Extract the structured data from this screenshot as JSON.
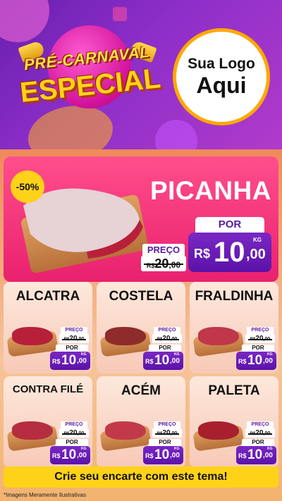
{
  "header": {
    "title_line1": "PRÉ-CARNAVAL",
    "title_line2": "ESPECIAL",
    "logo_line1": "Sua Logo",
    "logo_line2": "Aqui"
  },
  "hero": {
    "product": "PICANHA",
    "discount": "-50%",
    "preco_label": "PREÇO",
    "old_price_currency": "R$",
    "old_price_int": "20",
    "old_price_dec": ",00",
    "por_label": "POR",
    "currency": "R$",
    "price_int": "10",
    "price_dec": ",00",
    "price_unit": "KG"
  },
  "cards": [
    {
      "name": "ALCATRA",
      "preco_label": "PREÇO",
      "old_currency": "R$",
      "old_int": "20",
      "old_dec": ",00",
      "por_label": "POR",
      "currency": "R$",
      "price_int": "10",
      "price_dec": ",00",
      "unit": "KG"
    },
    {
      "name": "COSTELA",
      "preco_label": "PREÇO",
      "old_currency": "R$",
      "old_int": "20",
      "old_dec": ",00",
      "por_label": "POR",
      "currency": "R$",
      "price_int": "10",
      "price_dec": ",00",
      "unit": "KG"
    },
    {
      "name": "FRALDINHA",
      "preco_label": "PREÇO",
      "old_currency": "R$",
      "old_int": "20",
      "old_dec": ",00",
      "por_label": "POR",
      "currency": "R$",
      "price_int": "10",
      "price_dec": ",00",
      "unit": "KG"
    },
    {
      "name": "CONTRA FILÉ",
      "preco_label": "PREÇO",
      "old_currency": "R$",
      "old_int": "20",
      "old_dec": ",00",
      "por_label": "POR",
      "currency": "R$",
      "price_int": "10",
      "price_dec": ",00",
      "unit": "KG"
    },
    {
      "name": "ACÉM",
      "preco_label": "PREÇO",
      "old_currency": "R$",
      "old_int": "20",
      "old_dec": ",00",
      "por_label": "POR",
      "currency": "R$",
      "price_int": "10",
      "price_dec": ",00",
      "unit": "KG"
    },
    {
      "name": "PALETA",
      "preco_label": "PREÇO",
      "old_currency": "R$",
      "old_int": "20",
      "old_dec": ",00",
      "por_label": "POR",
      "currency": "R$",
      "price_int": "10",
      "price_dec": ",00",
      "unit": "KG"
    }
  ],
  "footer": {
    "cta": "Crie seu encarte com este tema!",
    "disclaimer": "*Imagens Meramente Ilustrativas"
  },
  "colors": {
    "header_purple": "#8e2fc9",
    "hero_pink": "#e9216d",
    "price_purple": "#5b12a8",
    "accent_yellow": "#ffd21a"
  }
}
